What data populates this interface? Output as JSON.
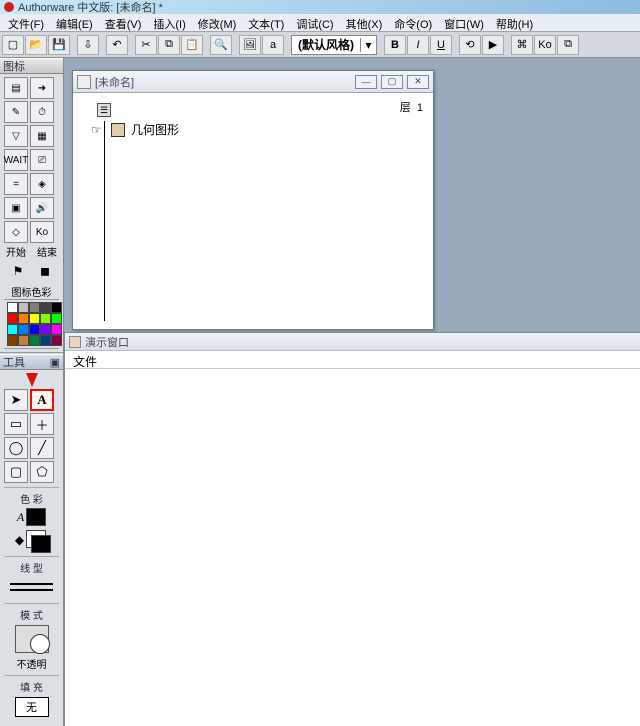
{
  "app": {
    "title": "Authorware 中文版: [未命名] *"
  },
  "menu": [
    "文件(F)",
    "编辑(E)",
    "查看(V)",
    "插入(I)",
    "修改(M)",
    "文本(T)",
    "调试(C)",
    "其他(X)",
    "命令(O)",
    "窗口(W)",
    "帮助(H)"
  ],
  "toolbar": {
    "style_label": "(默认风格)",
    "bold": "B",
    "italic": "I",
    "underline": "U"
  },
  "iconPanel": {
    "header": "图标",
    "startLabel": "开始",
    "endLabel": "结束",
    "colorHeader": "图标色彩",
    "swatches": [
      "#ffffff",
      "#c0c0c0",
      "#808080",
      "#404040",
      "#000000",
      "#ff0000",
      "#ff8000",
      "#ffff00",
      "#80ff00",
      "#00ff00",
      "#00ffff",
      "#0080ff",
      "#0000ff",
      "#8000ff",
      "#ff00ff",
      "#804000",
      "#c08040",
      "#008040",
      "#004080",
      "#800040"
    ]
  },
  "toolsPanel": {
    "header": "工具",
    "pointer": "pointer",
    "text": "A",
    "colorHeader": "色 彩",
    "lineHeader": "线 型",
    "modeHeader": "模 式",
    "modeLabel": "不透明",
    "fillHeader": "填 充",
    "fillLabel": "无"
  },
  "docWindow": {
    "title": "[未命名]",
    "layerLabel": "层",
    "layerValue": "1",
    "nodeLabel": "几何图形"
  },
  "previewWindow": {
    "title": "演示窗口",
    "menu": "文件"
  }
}
